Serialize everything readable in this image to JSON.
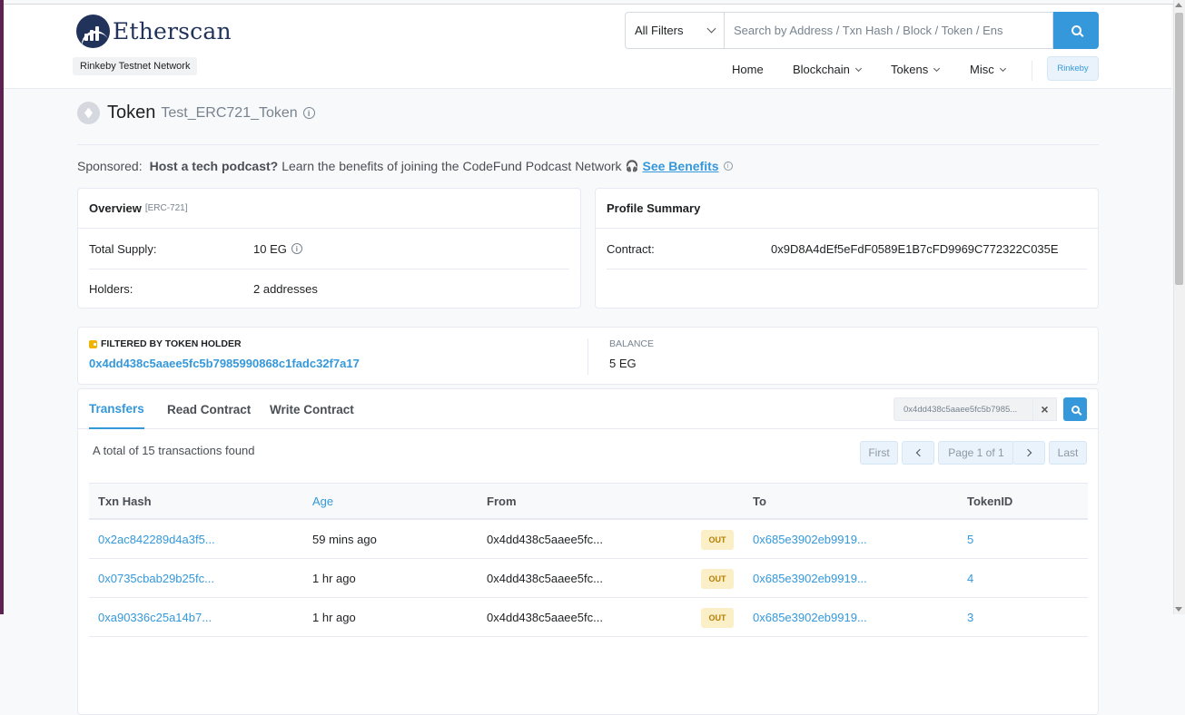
{
  "header": {
    "logo_text": "Etherscan",
    "network": "Rinkeby Testnet Network",
    "filter_label": "All Filters",
    "search_placeholder": "Search by Address / Txn Hash / Block / Token / Ens",
    "nav": [
      {
        "label": "Home",
        "dropdown": false
      },
      {
        "label": "Blockchain",
        "dropdown": true
      },
      {
        "label": "Tokens",
        "dropdown": true
      },
      {
        "label": "Misc",
        "dropdown": true
      }
    ],
    "network_button": "Rinkeby"
  },
  "token": {
    "label": "Token",
    "name": "Test_ERC721_Token"
  },
  "sponsored": {
    "prefix": "Sponsored:",
    "headline": "Host a tech podcast?",
    "text": "Learn the benefits of joining the CodeFund Podcast Network",
    "link": "See Benefits"
  },
  "overview": {
    "title": "Overview",
    "tag": "[ERC-721]",
    "total_supply_label": "Total Supply:",
    "total_supply_value": "10 EG",
    "holders_label": "Holders:",
    "holders_value": "2 addresses"
  },
  "profile": {
    "title": "Profile Summary",
    "contract_label": "Contract:",
    "contract_value": "0x9D8A4dEf5eFdF0589E1B7cFD9969C772322C035E"
  },
  "filter": {
    "title": "FILTERED BY TOKEN HOLDER",
    "address": "0x4dd438c5aaee5fc5b7985990868c1fadc32f7a17",
    "balance_label": "BALANCE",
    "balance_value": "5 EG"
  },
  "tabs": {
    "transfers": "Transfers",
    "read": "Read Contract",
    "write": "Write Contract",
    "search_value": "0x4dd438c5aaee5fc5b7985..."
  },
  "transfers": {
    "total": "A total of 15 transactions found",
    "pager": {
      "first": "First",
      "page": "Page 1 of 1",
      "last": "Last"
    },
    "columns": {
      "hash": "Txn Hash",
      "age": "Age",
      "from": "From",
      "to": "To",
      "token_id": "TokenID"
    },
    "rows": [
      {
        "hash": "0x2ac842289d4a3f5...",
        "age": "59 mins ago",
        "from": "0x4dd438c5aaee5fc...",
        "dir": "OUT",
        "to": "0x685e3902eb9919...",
        "token_id": "5"
      },
      {
        "hash": "0x0735cbab29b25fc...",
        "age": "1 hr ago",
        "from": "0x4dd438c5aaee5fc...",
        "dir": "OUT",
        "to": "0x685e3902eb9919...",
        "token_id": "4"
      },
      {
        "hash": "0xa90336c25a14b7...",
        "age": "1 hr ago",
        "from": "0x4dd438c5aaee5fc...",
        "dir": "OUT",
        "to": "0x685e3902eb9919...",
        "token_id": "3"
      }
    ]
  },
  "colors": {
    "accent": "#3498db",
    "brand": "#21325b",
    "out_badge": "#fbefc8"
  }
}
